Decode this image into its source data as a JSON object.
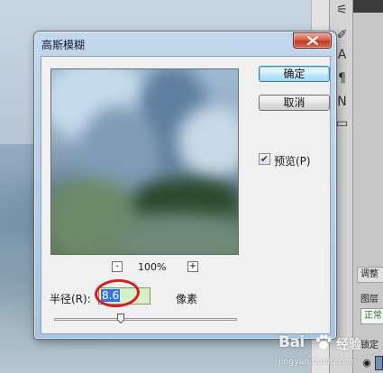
{
  "dialog": {
    "title": "高斯模糊",
    "ok_label": "确定",
    "cancel_label": "取消",
    "preview_checkbox_label": "预览(P)",
    "preview_checked": true,
    "zoom_level": "100%",
    "zoom_out_label": "-",
    "zoom_in_label": "+",
    "radius_label": "半径(R):",
    "radius_value": "8.6",
    "radius_unit": "像素"
  },
  "photoshop_panel": {
    "tab_adjust": "调整",
    "label_layers": "图层",
    "blend_mode": "正常",
    "label_lock": "锁定"
  },
  "watermark": {
    "brand": "Bai",
    "brand_suffix": "经验",
    "url": "jingyan.baidu.com"
  },
  "colors": {
    "close_button": "#c0391e",
    "default_button_border": "#3c7fb1",
    "radius_field_bg": "#d7f0c8",
    "selection": "#3875d7",
    "annotation_circle": "#d81d1d"
  }
}
